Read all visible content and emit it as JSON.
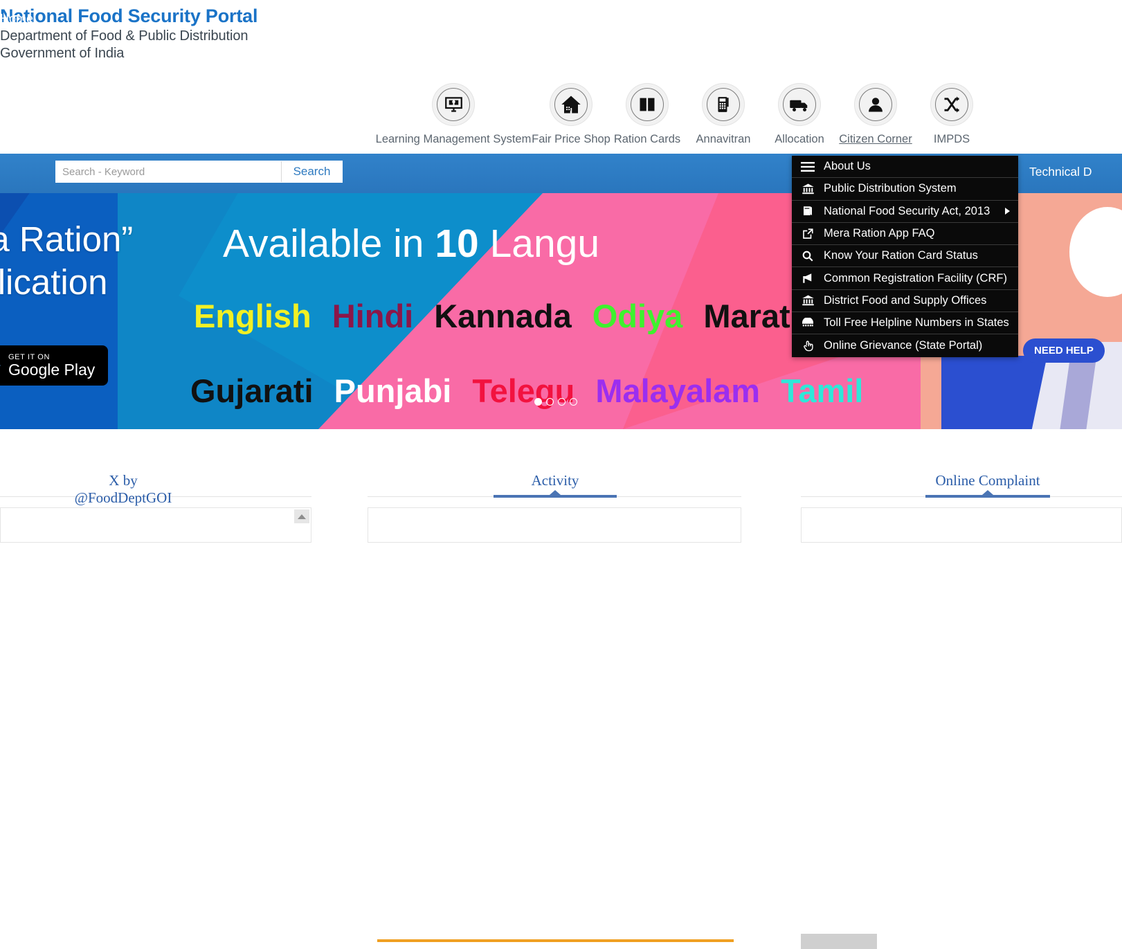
{
  "header": {
    "title": "National Food Security Portal",
    "subtitle_line1": "Department of Food & Public Distribution",
    "subtitle_line2": "Government of India"
  },
  "icon_nav": [
    {
      "label": "Learning Management System",
      "icon": "monitor-book-icon"
    },
    {
      "label": "Fair Price Shop",
      "icon": "home-icon"
    },
    {
      "label": "Ration Cards",
      "icon": "open-book-icon"
    },
    {
      "label": "Annavitran",
      "icon": "pos-machine-icon"
    },
    {
      "label": "Allocation",
      "icon": "truck-icon"
    },
    {
      "label": "Citizen Corner",
      "icon": "person-icon"
    },
    {
      "label": "IMPDS",
      "icon": "shuffle-icon"
    }
  ],
  "navbar": {
    "home_label": "Home",
    "search_placeholder": "Search - Keyword",
    "search_value": "",
    "search_button": "Search",
    "right_item": "Technical D"
  },
  "dropdown": {
    "items": [
      {
        "label": "About Us",
        "icon": "hamburger-icon",
        "has_submenu": false
      },
      {
        "label": "Public Distribution System",
        "icon": "bank-icon",
        "has_submenu": false
      },
      {
        "label": "National Food Security Act, 2013",
        "icon": "book-stack-icon",
        "has_submenu": true
      },
      {
        "label": "Mera Ration App FAQ",
        "icon": "external-link-icon",
        "has_submenu": false
      },
      {
        "label": "Know Your Ration Card Status",
        "icon": "search-icon",
        "has_submenu": false
      },
      {
        "label": "Common Registration Facility (CRF)",
        "icon": "megaphone-icon",
        "has_submenu": false
      },
      {
        "label": "District Food and Supply Offices",
        "icon": "bank-icon",
        "has_submenu": false
      },
      {
        "label": "Toll Free Helpline Numbers in States",
        "icon": "telephone-icon",
        "has_submenu": false
      },
      {
        "label": "Online Grievance (State Portal)",
        "icon": "hand-click-icon",
        "has_submenu": false
      }
    ]
  },
  "banner": {
    "headline_line1": "era Ration”",
    "headline_line2": "pplication",
    "available_prefix": "Available in ",
    "available_count": "10",
    "available_suffix": " Langu",
    "google_play_small": "GET IT ON",
    "google_play_big": "Google Play",
    "languages_row1": [
      {
        "name": "English",
        "color": "#f2f024"
      },
      {
        "name": "Hindi",
        "color": "#8c1648"
      },
      {
        "name": "Kannada",
        "color": "#111111"
      },
      {
        "name": "Odiya",
        "color": "#3ef22e"
      },
      {
        "name": "Marat",
        "color": "#111111"
      }
    ],
    "languages_row2": [
      {
        "name": "Gujarati",
        "color": "#111111"
      },
      {
        "name": "Punjabi",
        "color": "#ffffff"
      },
      {
        "name": "Telegu",
        "color": "#f2123f"
      },
      {
        "name": "Malayalam",
        "color": "#9b2ef0"
      },
      {
        "name": "Tamil",
        "color": "#2ee8d8"
      }
    ],
    "carousel_dots": 4,
    "carousel_active_index": 0,
    "need_help_label": "NEED HELP"
  },
  "bottom_tabs": [
    {
      "label": "X by @FoodDeptGOI"
    },
    {
      "label": "Activity"
    },
    {
      "label": "Online Complaint"
    }
  ],
  "colors": {
    "brand_blue": "#1a73c7",
    "nav_blue": "#2b7ac4",
    "tab_blue": "#2a5ca8",
    "menu_black": "#0a0a0a",
    "accent_orange": "#f0a022"
  }
}
